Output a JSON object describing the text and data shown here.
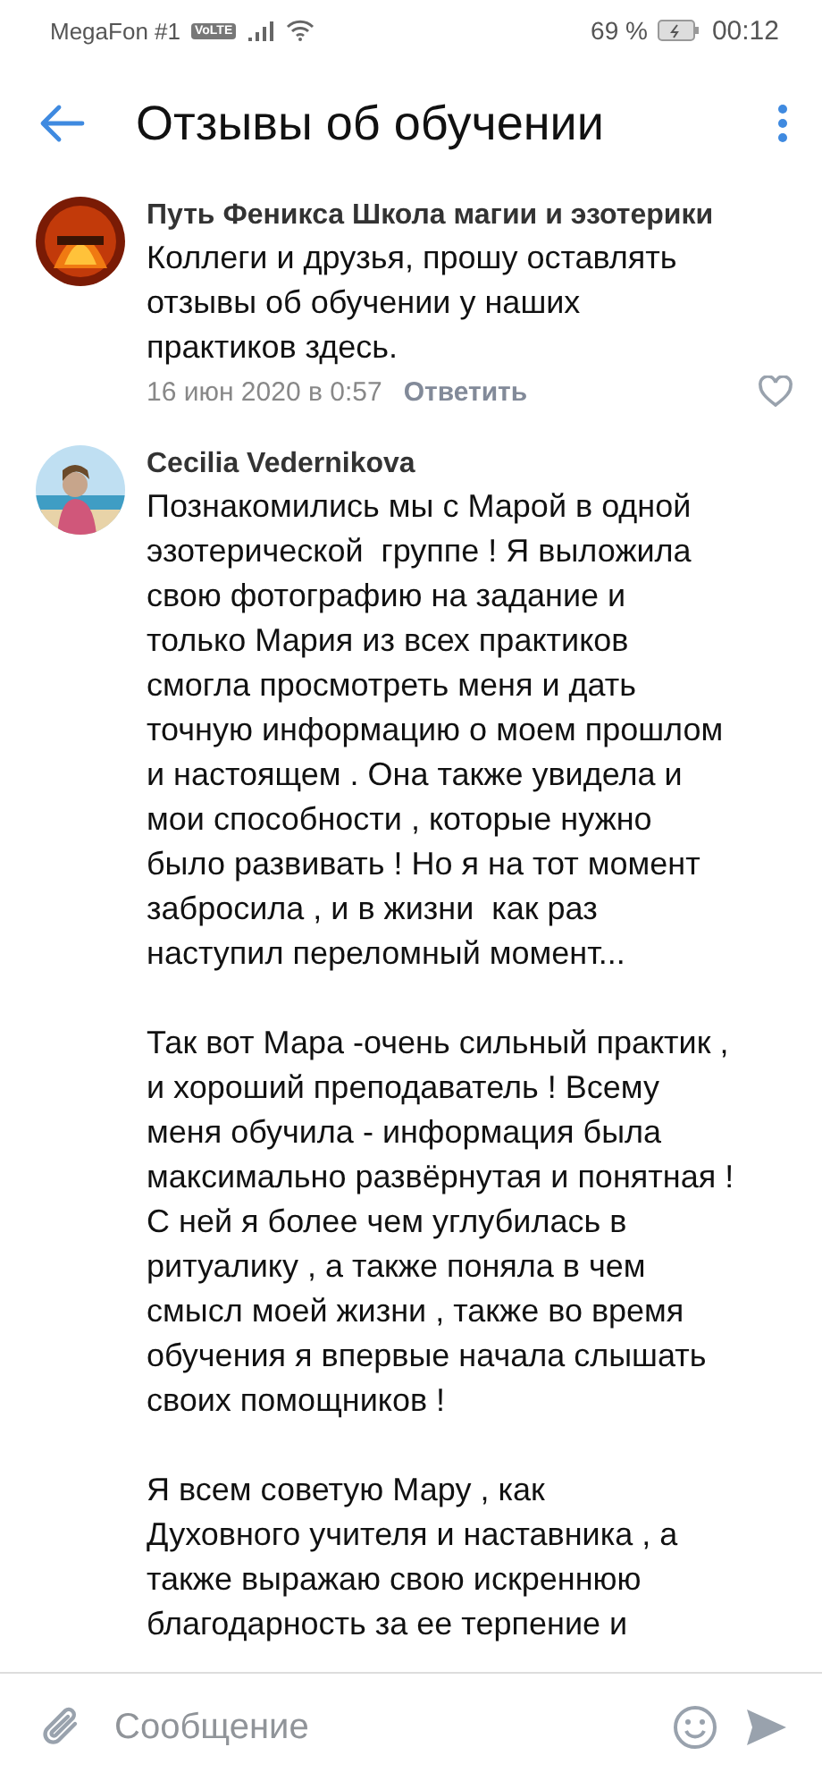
{
  "status_bar": {
    "carrier": "MegaFon #1",
    "volte": "VoLTE",
    "battery": "69 %",
    "time": "00:12"
  },
  "header": {
    "title": "Отзывы об обучении"
  },
  "comments": [
    {
      "author": "Путь Феникса Школа магии и эзотерики",
      "text": "Коллеги и друзья, прошу оставлять\nотзывы об обучении у наших\nпрактиков здесь.",
      "date": "16 июн 2020 в 0:57",
      "reply": "Ответить",
      "liked": false
    },
    {
      "author": "Cecilia Vedernikova",
      "text": "Познакомились мы с Марой в одной\nэзотерической  группе ! Я выложила\nсвою фотографию на задание и\nтолько Мария из всех практиков\nсмогла просмотреть меня и дать\nточную информацию о моем прошлом\nи настоящем . Она также увидела и\nмои способности , которые нужно\nбыло развивать ! Но я на тот момент\nзабросила , и в жизни  как раз\nнаступил переломный момент...\n\nТак вот Мара -очень сильный практик ,\nи хороший преподаватель ! Всему\nменя обучила - информация была\nмаксимально развёрнутая и понятная !\nС ней я более чем углубилась в\nритуалику , а также поняла в чем\nсмысл моей жизни , также во время\nобучения я впервые начала слышать\nсвоих помощников !\n\nЯ всем советую Мару , как\nДуховного учителя и наставника , а\nтакже выражаю свою искреннюю\nблагодарность за ее терпение и"
    }
  ],
  "composer": {
    "placeholder": "Сообщение"
  }
}
